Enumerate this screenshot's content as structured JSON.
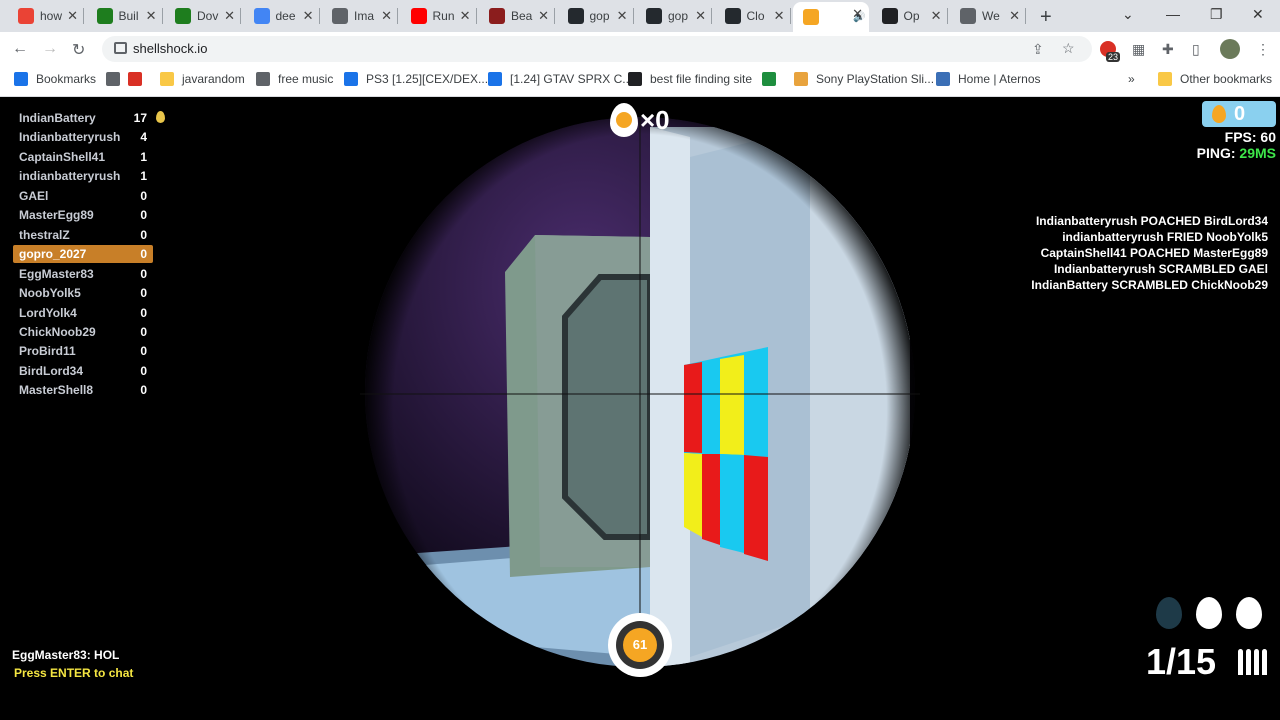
{
  "browser": {
    "tabs": [
      {
        "title": "how",
        "color": "#ea4335",
        "icon": "puzzle-icon"
      },
      {
        "title": "Buil",
        "color": "#1e7d1e",
        "icon": "nvidia-icon"
      },
      {
        "title": "Dov",
        "color": "#1e7d1e",
        "icon": "nvidia-icon"
      },
      {
        "title": "dee",
        "color": "#4285f4",
        "icon": "google-icon"
      },
      {
        "title": "Ima",
        "color": "#5f6368",
        "icon": "trend-icon"
      },
      {
        "title": "Run",
        "color": "#ff0000",
        "icon": "youtube-icon"
      },
      {
        "title": "Bea",
        "color": "#8b1d1d",
        "icon": "m-icon"
      },
      {
        "title": "gop",
        "color": "#24292e",
        "icon": "github-icon"
      },
      {
        "title": "gop",
        "color": "#24292e",
        "icon": "github-icon"
      },
      {
        "title": "Clo",
        "color": "#24292e",
        "icon": "github-icon"
      },
      {
        "title": "",
        "color": "#f5a623",
        "icon": "shellshock-icon"
      },
      {
        "title": "Op",
        "color": "#202124",
        "icon": "openai-icon"
      },
      {
        "title": "We",
        "color": "#5f6368",
        "icon": "globe-icon"
      }
    ],
    "url": "shellshock.io",
    "extension_badge": "23",
    "bookmarks": [
      {
        "label": "Bookmarks",
        "color": "#1a73e8"
      },
      {
        "label": "",
        "color": "#5f6368"
      },
      {
        "label": "",
        "color": "#d93025"
      },
      {
        "label": "javarandom",
        "color": "#f9c846"
      },
      {
        "label": "free music",
        "color": "#5f6368"
      },
      {
        "label": "PS3 [1.25][CEX/DEX...",
        "color": "#1a73e8"
      },
      {
        "label": "[1.24] GTAV SPRX C...",
        "color": "#1a73e8"
      },
      {
        "label": "best file finding site",
        "color": "#202124"
      },
      {
        "label": "",
        "color": "#1e8e3e"
      },
      {
        "label": "Sony PlayStation Sli...",
        "color": "#e8a33d"
      },
      {
        "label": "Home | Aternos",
        "color": "#3b6fb6"
      }
    ],
    "other_bookmarks": "Other bookmarks"
  },
  "game": {
    "scoreboard": [
      {
        "name": "IndianBattery",
        "score": "17"
      },
      {
        "name": "Indianbatteryrush",
        "score": "4"
      },
      {
        "name": "CaptainShell41",
        "score": "1"
      },
      {
        "name": "indianbatteryrush",
        "score": "1"
      },
      {
        "name": "GAEl",
        "score": "0"
      },
      {
        "name": "MasterEgg89",
        "score": "0"
      },
      {
        "name": "thestralZ",
        "score": "0"
      },
      {
        "name": "gopro_2027",
        "score": "0"
      },
      {
        "name": "EggMaster83",
        "score": "0"
      },
      {
        "name": "NoobYolk5",
        "score": "0"
      },
      {
        "name": "LordYolk4",
        "score": "0"
      },
      {
        "name": "ChickNoob29",
        "score": "0"
      },
      {
        "name": "ProBird11",
        "score": "0"
      },
      {
        "name": "BirdLord34",
        "score": "0"
      },
      {
        "name": "MasterShell8",
        "score": "0"
      }
    ],
    "current_player": "gopro_2027",
    "kill_streak": "×0",
    "eggs": "0",
    "fps_label": "FPS: 60",
    "ping_label": "PING:",
    "ping_value": "29MS",
    "killfeed": [
      "Indianbatteryrush POACHED BirdLord34",
      "indianbatteryrush FRIED NoobYolk5",
      "CaptainShell41 POACHED MasterEgg89",
      "Indianbatteryrush SCRAMBLED GAEl",
      "IndianBattery SCRAMBLED ChickNoob29"
    ],
    "chat_message": "EggMaster83: HOL",
    "chat_hint": "Press ENTER to chat",
    "health": "61",
    "ammo": "1/15",
    "grenades_available": 2,
    "grenades_total": 3,
    "colors": {
      "accent_orange": "#f5a623",
      "highlight_row": "#c87f28",
      "ping_green": "#3ee64a",
      "hint_yellow": "#f5e642"
    }
  }
}
